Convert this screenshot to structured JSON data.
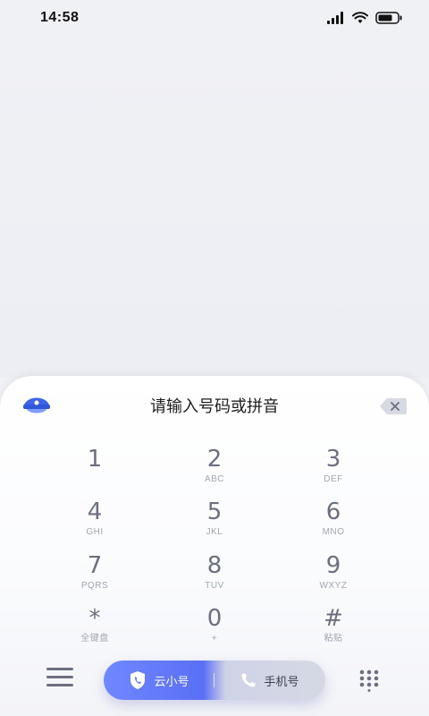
{
  "status_bar": {
    "time": "14:58"
  },
  "dialer": {
    "input_placeholder": "请输入号码或拼音",
    "keys": [
      {
        "digit": "1",
        "letters": ""
      },
      {
        "digit": "2",
        "letters": "ABC"
      },
      {
        "digit": "3",
        "letters": "DEF"
      },
      {
        "digit": "4",
        "letters": "GHI"
      },
      {
        "digit": "5",
        "letters": "JKL"
      },
      {
        "digit": "6",
        "letters": "MNO"
      },
      {
        "digit": "7",
        "letters": "PQRS"
      },
      {
        "digit": "8",
        "letters": "TUV"
      },
      {
        "digit": "9",
        "letters": "WXYZ"
      },
      {
        "digit": "*",
        "letters": "全键盘"
      },
      {
        "digit": "0",
        "letters": "+"
      },
      {
        "digit": "#",
        "letters": "粘贴"
      }
    ]
  },
  "bottom_bar": {
    "cloud_number_label": "云小号",
    "phone_number_label": "手机号"
  },
  "icons": {
    "menu": "menu-icon",
    "police": "police-cap-icon",
    "backspace": "backspace-icon",
    "keypad": "keypad-grid-icon",
    "shield_phone": "shield-phone-icon",
    "phone": "phone-icon"
  },
  "colors": {
    "accent": "#5a6ff5",
    "key_digit": "#6b6f80",
    "background": "#f0f1f5"
  }
}
